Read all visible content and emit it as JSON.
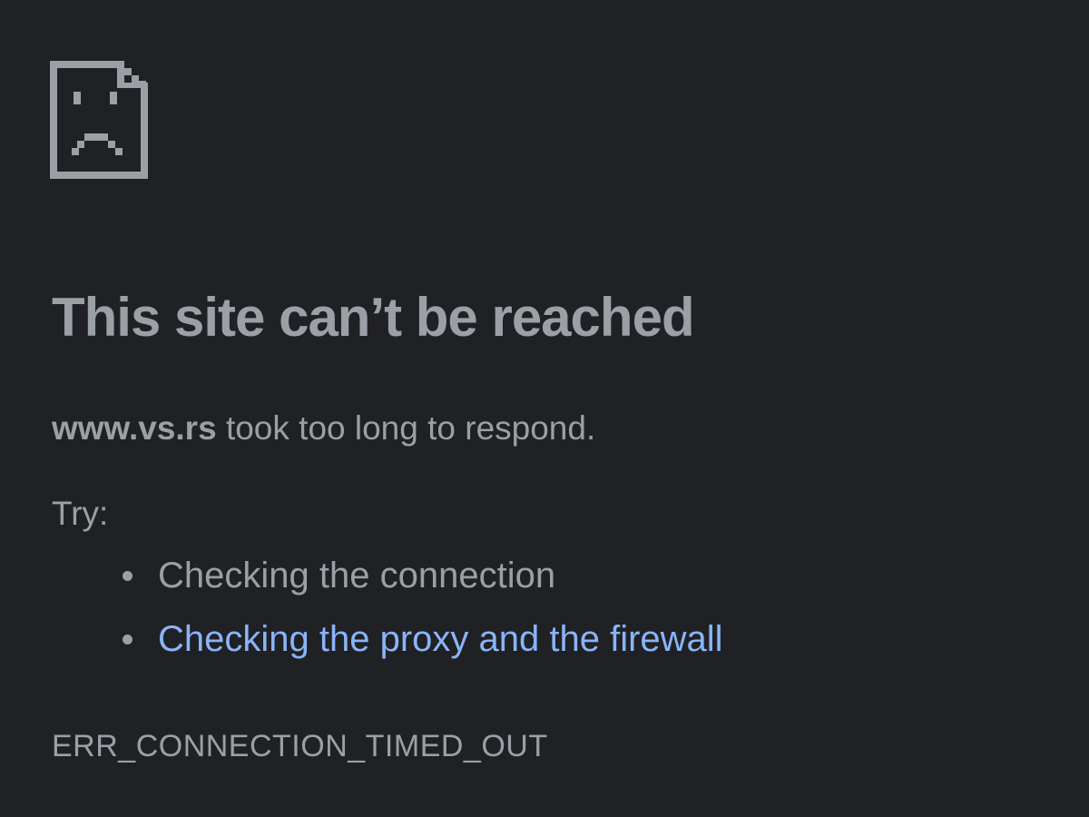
{
  "icon": "sad-page-icon",
  "heading": "This site can’t be reached",
  "summary": {
    "host": "www.vs.rs",
    "message": " took too long to respond."
  },
  "try_label": "Try:",
  "suggestions": [
    {
      "text": "Checking the connection",
      "is_link": false
    },
    {
      "text": "Checking the proxy and the firewall",
      "is_link": true
    }
  ],
  "error_code": "ERR_CONNECTION_TIMED_OUT",
  "colors": {
    "background": "#202124",
    "text": "#9aa0a6",
    "link": "#8ab4f8"
  }
}
